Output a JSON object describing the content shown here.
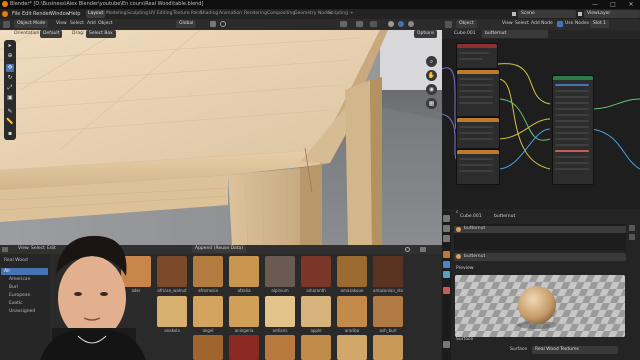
{
  "window": {
    "title": "Blender* [D:\\Business\\Alex Blender\\youtube\\En cours\\Real Wood\\table.blend]",
    "min_glyph": "—",
    "max_glyph": "□",
    "close_glyph": "✕"
  },
  "menus": [
    "File",
    "Edit",
    "Render",
    "Window",
    "Help"
  ],
  "workspaces": [
    "Layout",
    "Modeling",
    "Sculpting",
    "UV Editing",
    "Texture Paint",
    "Shading",
    "Animation",
    "Rendering",
    "Compositing",
    "Geometry Nodes",
    "Scripting",
    "+"
  ],
  "active_workspace": "Layout",
  "topright": {
    "scene": "Scene",
    "viewlayer": "ViewLayer"
  },
  "viewport": {
    "orientation_label": "Orientation:",
    "orientation_value": "Default",
    "drag_label": "Drag:",
    "drag_value": "Select Box",
    "options": "Options",
    "mode": "Object Mode",
    "menu": [
      "View",
      "Select",
      "Add",
      "Object"
    ],
    "transform": "Global"
  },
  "asset_browser": {
    "menu": [
      "View",
      "Select",
      "Edit"
    ],
    "library": "Real Wood",
    "import": "Append (Reuse Data)",
    "categories": [
      "All",
      "American",
      "Burl",
      "European",
      "Exotic",
      "Unassigned"
    ],
    "active_category": "All",
    "assets_row1": [
      "ader",
      "african_walnut",
      "afromosia",
      "afzelia",
      "alpinium",
      "amaranth",
      "amazakoue",
      "amazonian_ston..."
    ],
    "assets_row2": [
      "",
      "anakola",
      "angel",
      "aningeria",
      "antiaris",
      "apple",
      "arariba",
      "ash_burl"
    ]
  },
  "node_editor": {
    "object_menu": "Object",
    "menu": [
      "View",
      "Select",
      "Add",
      "Node"
    ],
    "use_nodes": "Use Nodes",
    "slot": "Slot 1",
    "object": "Cube.001",
    "material": "butternut"
  },
  "properties": {
    "object": "Cube.001",
    "material": "butternut",
    "slot_material": "butternut",
    "search_material": "butternut",
    "preview_label": "Preview",
    "surface_label": "Surface",
    "surface_field": "Surface",
    "surface_value": "Real Wood Textures"
  },
  "colors": {
    "accent": "#4772b3",
    "node_header_green": "#2d7a4a",
    "node_header_orange": "#c07a30",
    "node_header_red": "#8a3030",
    "link_yellow": "#d4c440",
    "link_purple": "#7b6fd0",
    "link_green": "#64c074",
    "link_blue": "#4aa0e0"
  },
  "icons": [
    "blender-logo-icon",
    "select-box-icon",
    "cursor-icon",
    "move-icon",
    "rotate-icon",
    "scale-icon",
    "transform-icon",
    "annotate-icon",
    "measure-icon",
    "zoom-icon",
    "hand-icon",
    "camera-icon",
    "grid-icon",
    "search-icon",
    "filter-icon",
    "material-icon",
    "object-icon"
  ]
}
